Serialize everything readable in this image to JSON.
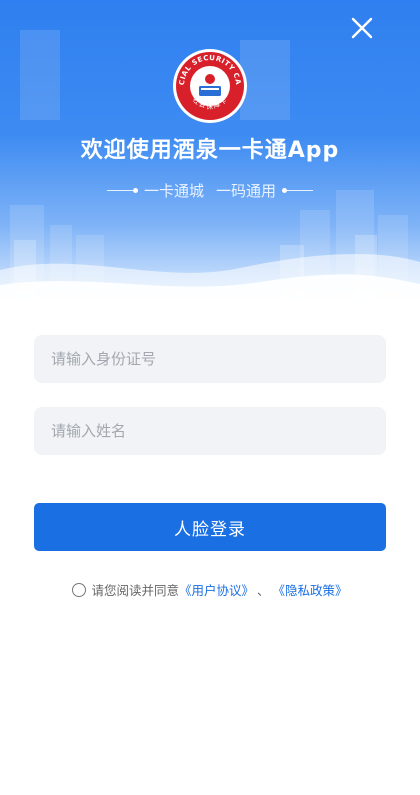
{
  "header": {
    "title": "欢迎使用酒泉一卡通App",
    "slogan_left": "一卡通城",
    "slogan_right": "一码通用",
    "close_icon": "close-icon",
    "logo": {
      "icon": "social-security-card-logo",
      "arc_text": "SOCIAL SECURITY CARD",
      "bottom_text": "社会保障卡"
    }
  },
  "form": {
    "id_placeholder": "请输入身份证号",
    "name_placeholder": "请输入姓名",
    "login_label": "人脸登录"
  },
  "agreement": {
    "prefix": "请您阅读并同意",
    "user_agreement": "《用户协议》",
    "separator": "、",
    "privacy_policy": "《隐私政策》"
  },
  "colors": {
    "primary": "#1a6fe3",
    "hero_top": "#2f7ff0",
    "field_bg": "#f1f3f6",
    "logo_red": "#d8202a"
  }
}
